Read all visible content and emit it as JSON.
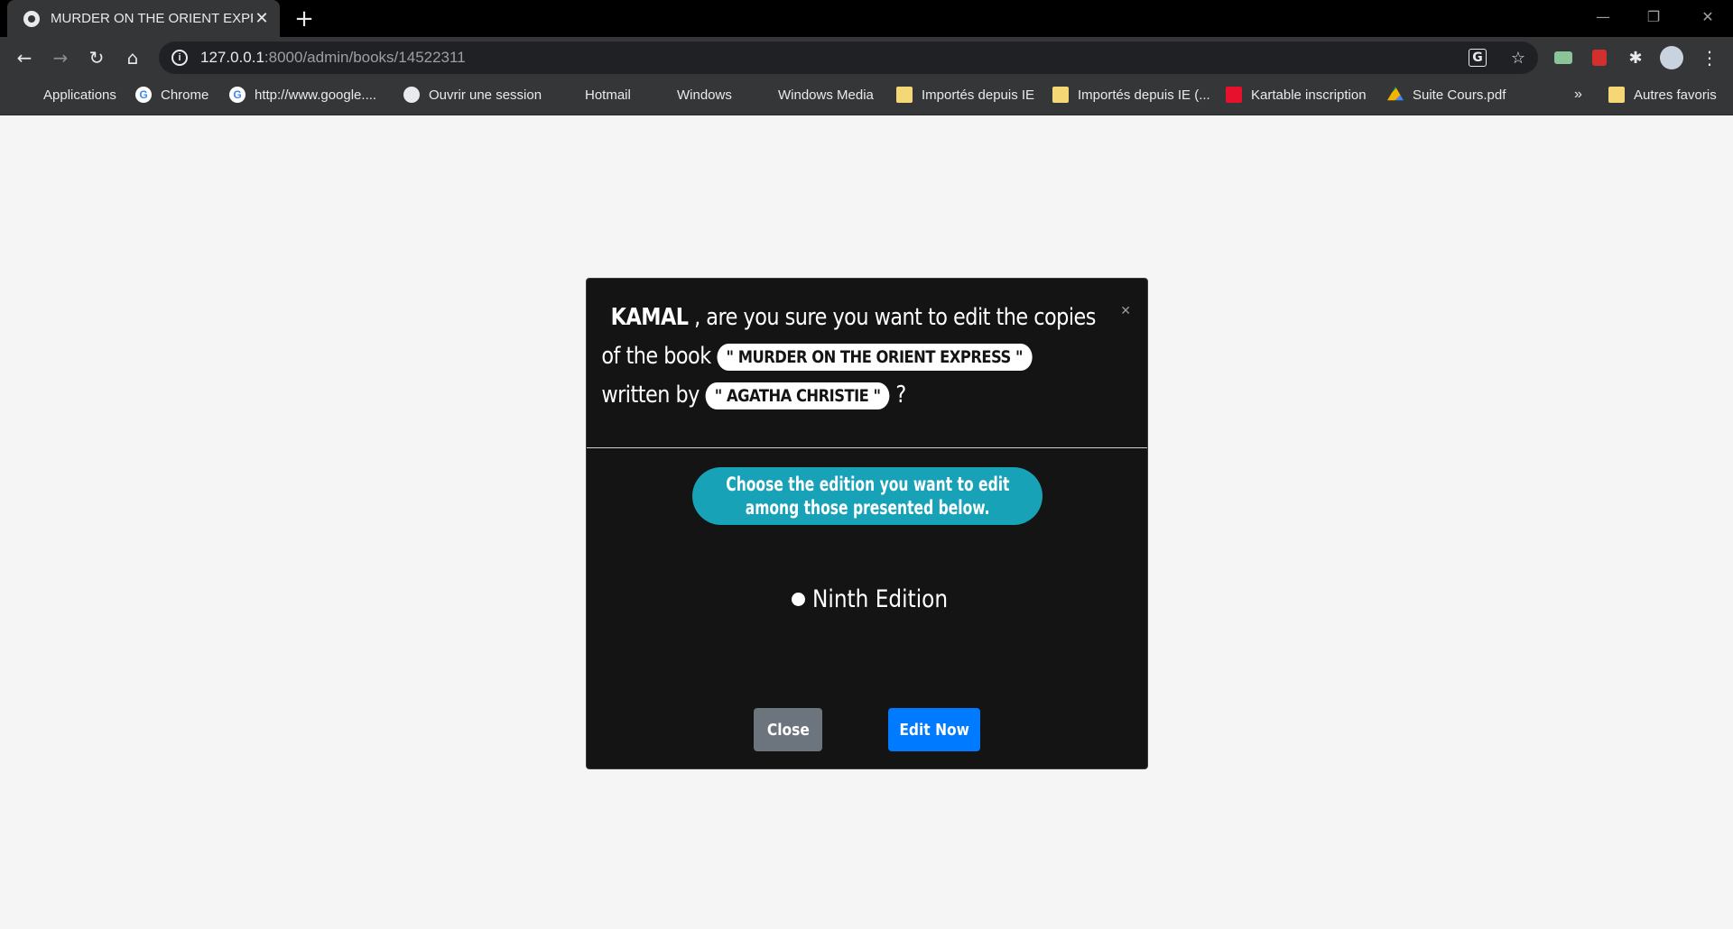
{
  "tab": {
    "title": "MURDER ON THE ORIENT EXPRE",
    "close": "✕"
  },
  "newtab": "+",
  "window_controls": {
    "minimize": "—",
    "maximize": "❐",
    "close": "✕"
  },
  "nav": {
    "back": "←",
    "forward": "→",
    "reload": "↻",
    "home": "⌂"
  },
  "address": {
    "host": "127.0.0.1",
    "path": ":8000/admin/books/14522311",
    "info": "i"
  },
  "omnibox_icons": {
    "translate": "G",
    "star": "☆"
  },
  "bookmarks": {
    "items": [
      {
        "label": "Applications"
      },
      {
        "label": "Chrome"
      },
      {
        "label": "http://www.google...."
      },
      {
        "label": "Ouvrir une session"
      },
      {
        "label": "Hotmail"
      },
      {
        "label": "Windows"
      },
      {
        "label": "Windows Media"
      },
      {
        "label": "Importés depuis IE"
      },
      {
        "label": "Importés depuis IE (..."
      },
      {
        "label": "Kartable inscription"
      },
      {
        "label": "Suite Cours.pdf"
      }
    ],
    "overflow": "»",
    "other": "Autres favoris"
  },
  "modal": {
    "user": "KAMAL",
    "text_1": " , are you sure you want to edit the copies of the book ",
    "book_title": "\" MURDER ON THE ORIENT EXPRESS \"",
    "text_2": " written by ",
    "author": "\" AGATHA CHRISTIE \"",
    "text_3": " ?",
    "close_x": "✕",
    "banner_line1": "Choose the edition you want to edit",
    "banner_line2": "among those presented below.",
    "edition": "Ninth Edition",
    "close_button": "Close",
    "edit_button": "Edit Now"
  },
  "colors": {
    "modal_bg": "#141414",
    "banner": "#17a2b8",
    "close_btn": "#6c757d",
    "edit_btn": "#007bff",
    "page_bg": "#f5f5f5"
  }
}
